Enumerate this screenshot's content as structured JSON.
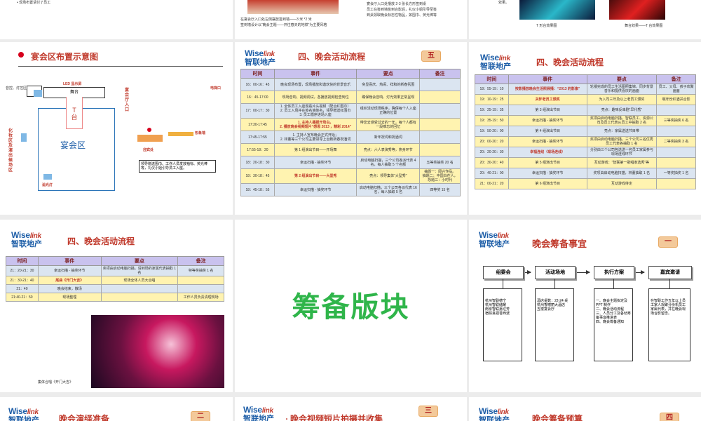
{
  "row0": {
    "s1": {
      "bullet": "• 现场布置请付了员工"
    },
    "s2": {
      "line1": "在宴会厅入口处左侧摆放签到墙——3 米 *2 米",
      "line2": "签到墙设计以“晚会主题——开往春天的地铁”为主要风格",
      "right_line1": "宴会厅入口处摆放 2-3 张长方形签到桌",
      "right_line2": "员工在签到墙签到合影后，礼仪小姐引导至签",
      "right_line3": "到桌领取晚会标志性物品，如围巾、荧光棒等"
    },
    "s3": {
      "caption1": "T 形台效果图",
      "caption2": "舞台效果——T 台效果图",
      "top_text": "效果。"
    }
  },
  "layout_slide": {
    "title": "宴会区布置示意图",
    "label_audio": "音控、灯控区域",
    "label_led": "LED 显示屏",
    "label_stage": "舞台",
    "label_t": "T\n台",
    "label_hall": "宴会区",
    "label_makeup": "化妆区及演出候场区",
    "label_entrance": "宴会厅入口",
    "label_elevator": "电梯口",
    "label_signwall": "形象墙",
    "label_welcome": "迎宾处",
    "label_light": "追光灯",
    "note": "领导赠送围巾、工作人员发放袖标、荧光棒等，礼仪小姐引导员工入座。"
  },
  "flow": {
    "logo_en": "Wise",
    "logo_en2": "link",
    "logo_cn": "智联地产",
    "title": "四、晚会活动流程",
    "badge": "五",
    "headers": [
      "时间",
      "事件",
      "要点",
      "备注"
    ]
  },
  "flow1": {
    "rows": [
      [
        "16：00-16：45",
        "晚会现场布置，现场播放和谐欢快的背景音乐",
        "突显喜庆、热闹、祥和的新春氛围",
        ""
      ],
      [
        "16：45-17:00",
        "现场音响、视频调试，各播放视频检查到位",
        "确保晚会音响、灯光效果正常呈现",
        ""
      ],
      [
        "17：00-17：30",
        "1. 全体员工入座观看片头视频（配合红围巾）\n2. 员工入场并在签名墙签名，领导赠送红围巾\n3. 员工循序进场入座",
        "组织活动现场秩序，确保每个人入座正确的位置",
        ""
      ],
      [
        "17:30-17:45",
        "1. 主持人播报开场白。\n2. 播放晚会视频短片“感恩 2013 ，精彩 2014”",
        "带您去感受过去的一年，每个人都有一段难忘的回忆",
        ""
      ],
      [
        "17:45-17:55",
        "1. 主持人宣布晚会正式开始；\n2. 林董等三个公司主要领导上台致新春祝酒词",
        "新年祝词和祝酒词",
        ""
      ],
      [
        "17:55-18：20",
        "第 1 组演出节目——开场舞",
        "亮点：六人表演秀等，热身环节",
        ""
      ],
      [
        "18：20-18：30",
        "幸运扫描 - 抽奖环节",
        "启动电脑扫描，三个公司各派代表 4 名，每人抽取 5 个名额",
        "五等奖抽奖 20 名"
      ],
      [
        "18：30-18：45",
        "第 2 组演出节目——大型秀",
        "亮点：领导集体“大型秀”",
        "抽题一：即兴作品。\n抽题二：中国白在人，恐题三：小时代"
      ],
      [
        "18：45-18：55",
        "幸运扫描 - 抽奖环节",
        "启动电脑扫描，三个公司各派代表 16 名，每人抽取 5 名",
        "四等奖 15 名"
      ]
    ]
  },
  "flow2": {
    "rows": [
      [
        "18：55-19：10",
        "按影播放晚会生活照展播：“2013 的影像”",
        "轮播完成的员工生活图照集锦，同步背景音乐和提供喜庆的画面",
        "员工、父母、孩子欢聚画面"
      ],
      [
        "19：10-19：25",
        "关怀老员工颁奖",
        "为入司三年及以上老员工颁奖",
        "嘱年份红酒并合影"
      ],
      [
        "19：25-19：35",
        "第 3 组演出节目",
        "亮点：趣味反串剧“早代秀”",
        ""
      ],
      [
        "19：35-19：50",
        "幸运扫描 - 抽奖环节",
        "奖项由启动电脑扫描，智联员工、资源公司及员工代表从员工中抽取 2 名",
        "三等奖抽奖 6 名"
      ],
      [
        "19：50-20：00",
        "第 4 组演出节目",
        "亮点：家属送送节目带",
        ""
      ],
      [
        "20：00-20：20",
        "幸运扫描 - 抽奖环节",
        "奖项由启动电脑扫描，三个公司三名优秀员工代表各抽取 1 名",
        "二等奖抽奖 3 名"
      ],
      [
        "20：20-20：30",
        "幸福连线（现场连线）",
        "分别由三个公司各选送一名员工家属参与现场连线环节",
        ""
      ],
      [
        "20：30-20：40",
        "第 5 组演出节目",
        "互动游戏：“智联第一歌唱家选秀”等",
        ""
      ],
      [
        "20：40-21：00",
        "幸运扫描 - 抽奖环节",
        "奖项由启动电脑扫描，林董抽取 1 名",
        "一等奖抽奖 1 名"
      ],
      [
        "21：00-21：20",
        "第 6 组演出节目",
        "互动游戏待定",
        ""
      ]
    ]
  },
  "flow3": {
    "rows": [
      [
        "21：20-21：30",
        "幸运扫描 - 抽奖环节",
        "奖项由启动电脑扫描，请到场的家属代表抽取 1 名",
        "特等奖抽奖 1 名"
      ],
      [
        "21：30-21：40",
        "尾曲《开门大吉》",
        "现场全体人员大合唱",
        ""
      ],
      [
        "21：40",
        "晚会结束，散场",
        "",
        ""
      ],
      [
        "21:40-21：50",
        "现场整理",
        "",
        "工作人员负责清理现场"
      ]
    ],
    "photo_caption": "集体合唱《开门大吉》"
  },
  "section": {
    "text": "筹备版块"
  },
  "prep": {
    "title": "晚会筹备事宜",
    "badge": "一",
    "cols": [
      {
        "head": "组委会",
        "body": "杭州智联德宁\n杭州智联储耀\n南京智联嘉垃芳\n宿棕良视苍西波"
      },
      {
        "head": "活动场地",
        "body": "酒店桌数：22-24 桌\n杭州香榭丽大酒店\n五楼宴会厅"
      },
      {
        "head": "执行方案",
        "body": "一、晚会主题拟定及 PPT 制作\n二、晚会活动流程\n三、人员分工及各劝筹备事宜推进表\n四、晚会筹备通知"
      },
      {
        "head": "嘉宾邀请",
        "body": "在智联工作五年以上员工家人观聚分份机员工家属代表，并在晚会现场合影留念。"
      }
    ]
  },
  "bottom": {
    "t1": "晚会演绎准备",
    "b1": "二",
    "t2": "晚会视频短片拍摄并收集",
    "b2": "三",
    "t3": "晚会筹备预算",
    "b3": "四"
  }
}
